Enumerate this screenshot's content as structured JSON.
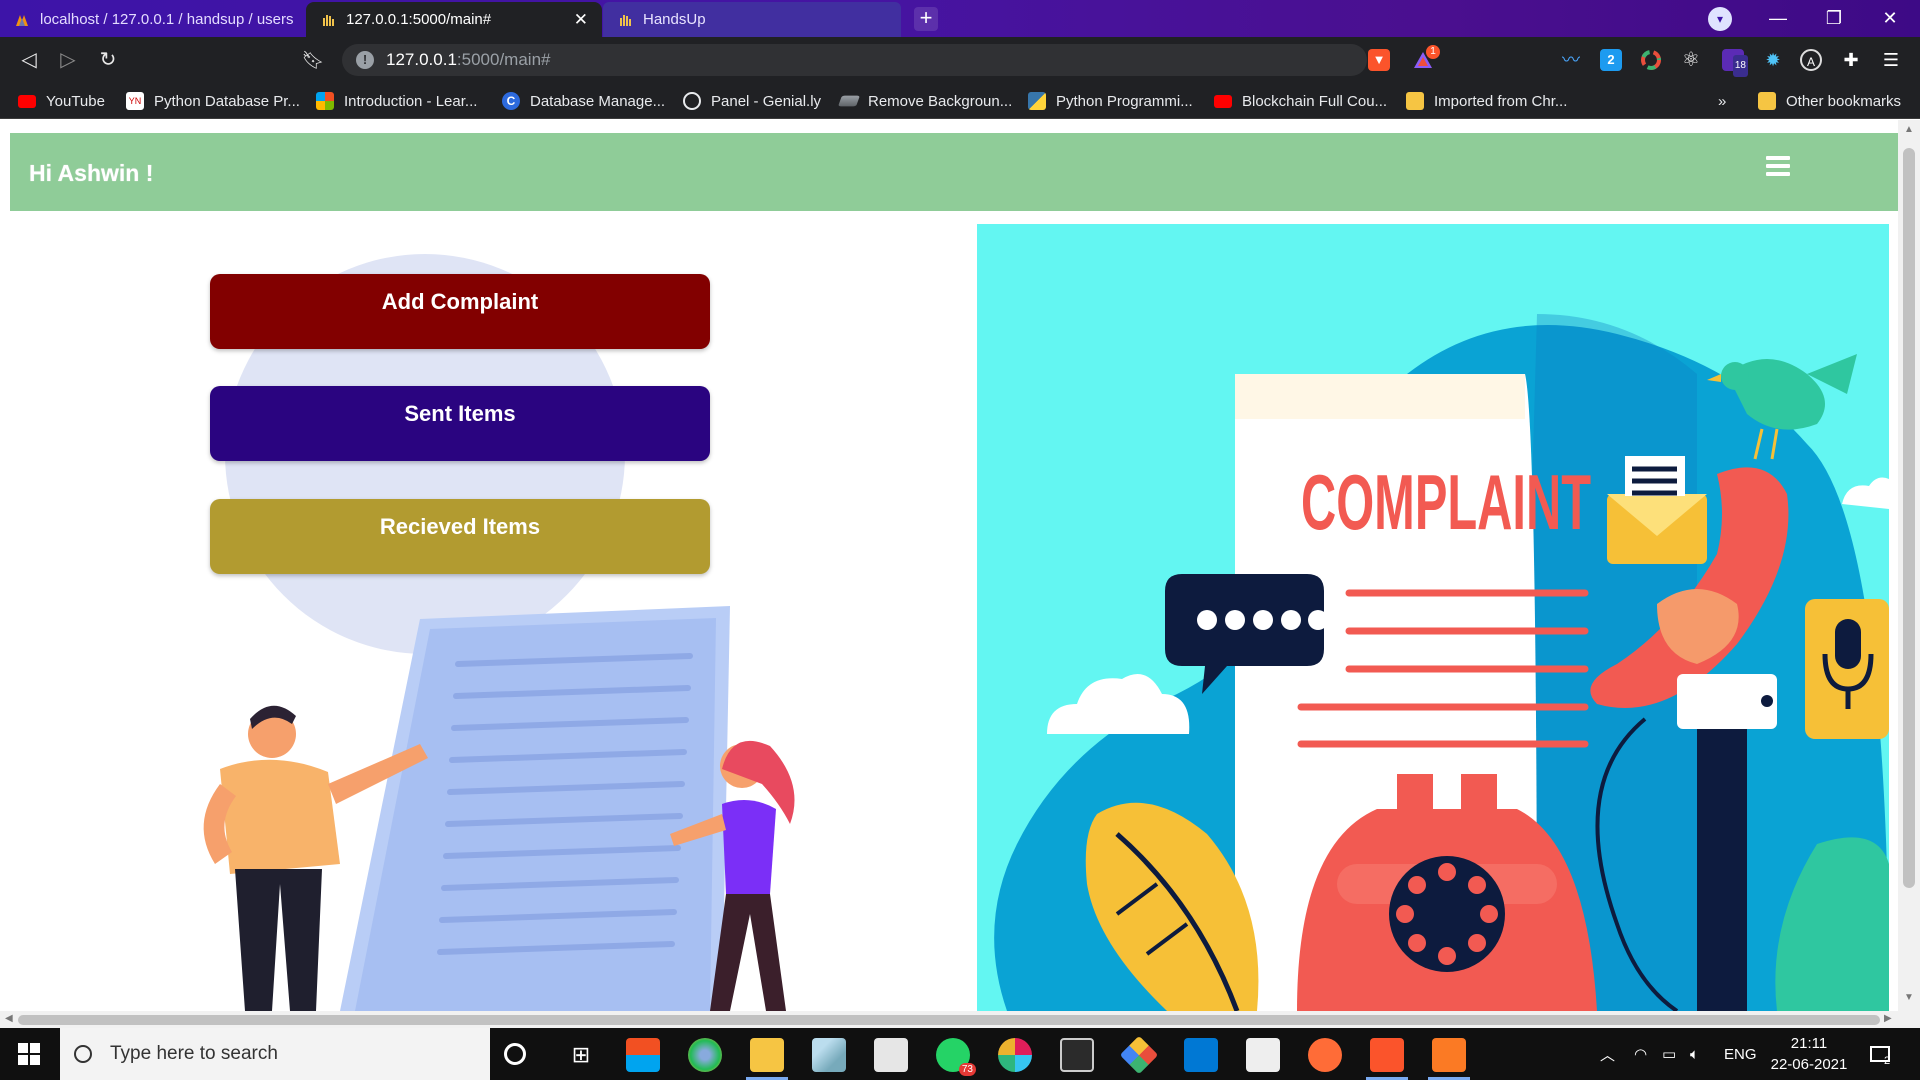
{
  "browser": {
    "tabs": [
      {
        "title": "localhost / 127.0.0.1 / handsup / users",
        "active": false
      },
      {
        "title": "127.0.0.1:5000/main#",
        "active": true
      },
      {
        "title": "HandsUp",
        "active": false
      }
    ],
    "address": {
      "host": "127.0.0.1",
      "rest": ":5000/main#"
    },
    "bookmarks": [
      {
        "label": "YouTube",
        "icon": "youtube-icon"
      },
      {
        "label": "Python Database Pr...",
        "icon": "yn-icon"
      },
      {
        "label": "Introduction - Lear...",
        "icon": "microsoft-icon"
      },
      {
        "label": "Database Manage...",
        "icon": "c-icon"
      },
      {
        "label": "Panel - Genial.ly",
        "icon": "genially-icon"
      },
      {
        "label": "Remove Backgroun...",
        "icon": "layers-icon"
      },
      {
        "label": "Python Programmi...",
        "icon": "python-icon"
      },
      {
        "label": "Blockchain Full Cou...",
        "icon": "youtube-icon"
      },
      {
        "label": "Imported from Chr...",
        "icon": "folder-icon"
      }
    ],
    "overflow": "»",
    "other_bookmarks": "Other bookmarks",
    "ext_badges": {
      "brave_rewards": "1",
      "twitter_count": "2",
      "purple_badge": "18"
    }
  },
  "page": {
    "greeting": "Hi Ashwin !",
    "buttons": {
      "add_complaint": "Add Complaint",
      "sent_items": "Sent Items",
      "received_items": "Recieved Items"
    },
    "illustration_text": "COMPLAINT"
  },
  "taskbar": {
    "search_placeholder": "Type here to search",
    "whatsapp_badge": "73",
    "language": "ENG",
    "time": "21:11",
    "date": "22-06-2021",
    "notifications": "2"
  },
  "colors": {
    "navbar": "#8fcc98",
    "add_complaint": "#820000",
    "sent_items": "#2a0480",
    "received_items": "#b29b30",
    "illustration_bg": "#63f6f2"
  }
}
